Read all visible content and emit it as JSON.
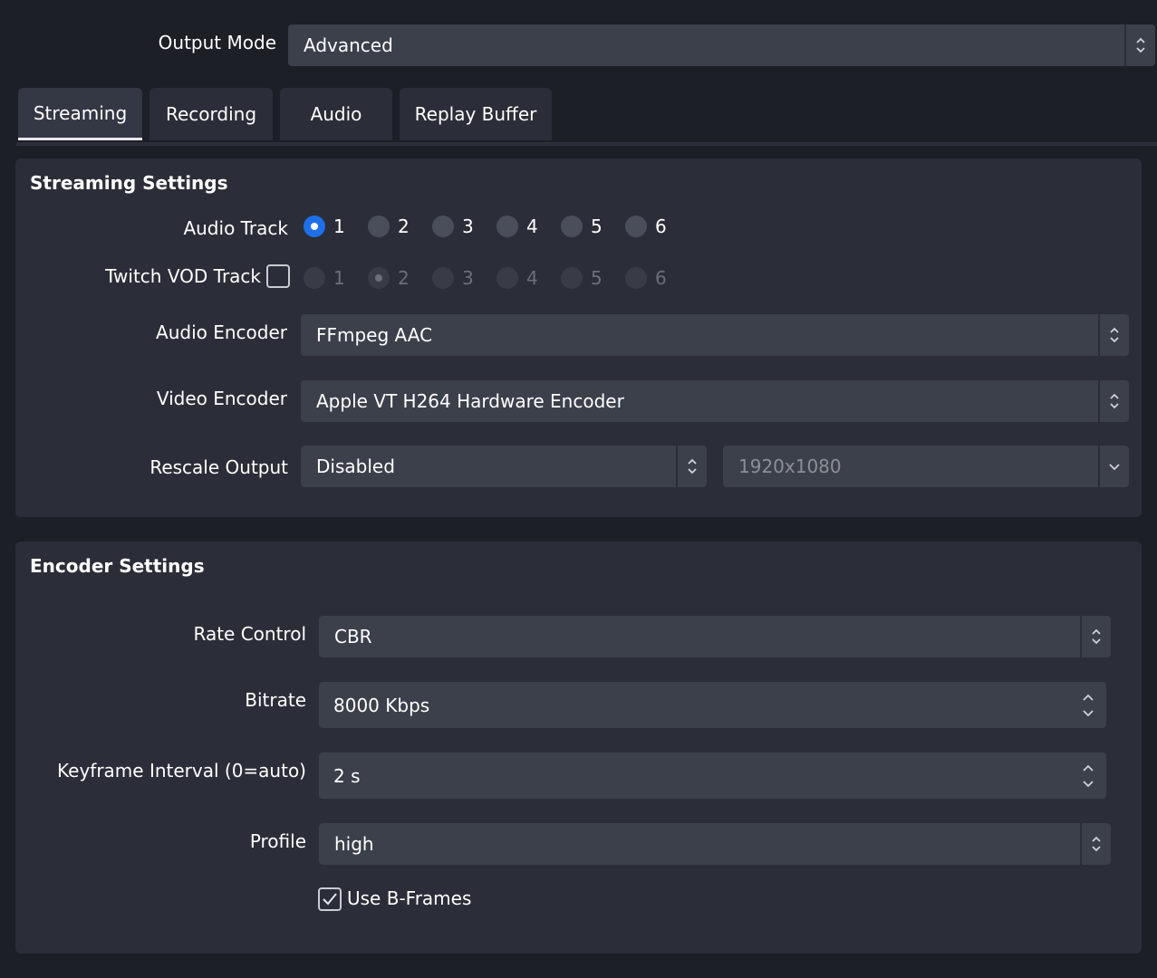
{
  "output_mode": {
    "label": "Output Mode",
    "value": "Advanced"
  },
  "tabs": [
    {
      "label": "Streaming",
      "active": true
    },
    {
      "label": "Recording",
      "active": false
    },
    {
      "label": "Audio",
      "active": false
    },
    {
      "label": "Replay Buffer",
      "active": false
    }
  ],
  "streaming": {
    "title": "Streaming Settings",
    "audio_track": {
      "label": "Audio Track",
      "options": [
        "1",
        "2",
        "3",
        "4",
        "5",
        "6"
      ],
      "selected": "1"
    },
    "twitch_vod": {
      "label": "Twitch VOD Track",
      "checked": false,
      "options": [
        "1",
        "2",
        "3",
        "4",
        "5",
        "6"
      ],
      "selected": "2"
    },
    "audio_encoder": {
      "label": "Audio Encoder",
      "value": "FFmpeg AAC"
    },
    "video_encoder": {
      "label": "Video Encoder",
      "value": "Apple VT H264 Hardware Encoder"
    },
    "rescale": {
      "label": "Rescale Output",
      "value": "Disabled",
      "resolution": "1920x1080"
    }
  },
  "encoder": {
    "title": "Encoder Settings",
    "rate_control": {
      "label": "Rate Control",
      "value": "CBR"
    },
    "bitrate": {
      "label": "Bitrate",
      "value": "8000 Kbps"
    },
    "keyframe": {
      "label": "Keyframe Interval (0=auto)",
      "value": "2 s"
    },
    "profile": {
      "label": "Profile",
      "value": "high"
    },
    "bframes": {
      "label": "Use B-Frames",
      "checked": true
    }
  },
  "colors": {
    "accent": "#1e6fe8",
    "background": "#1d1f26",
    "panel": "#2b2e38",
    "field": "#3c404b"
  }
}
